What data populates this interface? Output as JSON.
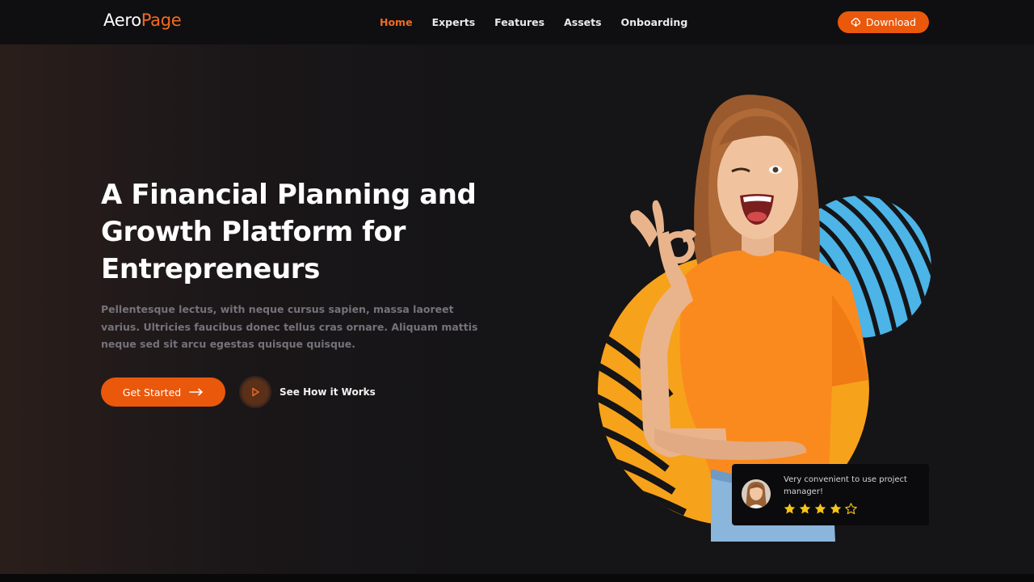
{
  "brand": {
    "part1": "Aero",
    "part2": "Page"
  },
  "nav": {
    "items": [
      {
        "label": "Home",
        "active": true
      },
      {
        "label": "Experts",
        "active": false
      },
      {
        "label": "Features",
        "active": false
      },
      {
        "label": "Assets",
        "active": false
      },
      {
        "label": "Onboarding",
        "active": false
      }
    ],
    "download_label": "Download",
    "download_icon": "cloud-download-icon"
  },
  "hero": {
    "headline_line1": "A Financial Planning and",
    "headline_line2": "Growth Platform for",
    "headline_line3": "Entrepreneurs",
    "subtext": "Pellentesque lectus, with neque cursus sapien, massa laoreet varius. Ultricies faucibus donec tellus cras ornare. Aliquam mattis neque sed sit arcu egestas quisque quisque.",
    "cta_label": "Get Started",
    "cta_icon": "arrow-right-icon",
    "video_label": "See How it Works",
    "video_icon": "play-icon"
  },
  "review": {
    "text": "Very convenient to use project manager!",
    "rating": 4,
    "max_rating": 5
  },
  "colors": {
    "accent": "#ea580c",
    "background": "#141416",
    "navbar": "#0f0f11",
    "shape_blue": "#4cb4e7",
    "shape_orange": "#f7a21b",
    "star": "#f5c518"
  }
}
